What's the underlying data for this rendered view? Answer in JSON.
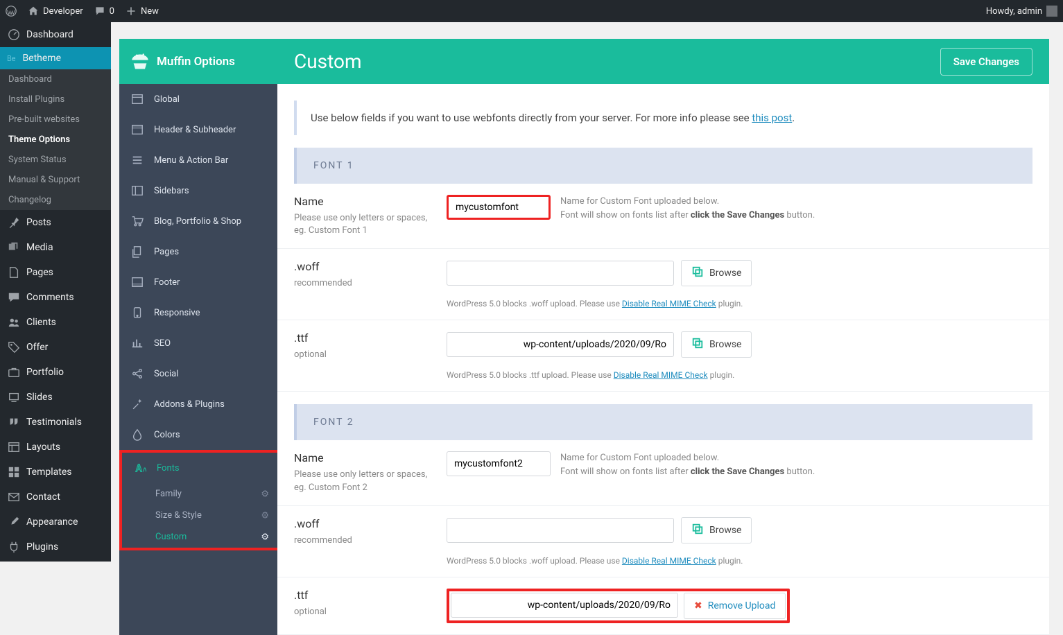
{
  "adminbar": {
    "site": "Developer",
    "comments": "0",
    "new": "New",
    "howdy": "Howdy, admin"
  },
  "wpmenu": {
    "dashboard": "Dashboard",
    "betheme": "Betheme",
    "sub": {
      "dashboard": "Dashboard",
      "install_plugins": "Install Plugins",
      "prebuilt": "Pre-built websites",
      "theme_options": "Theme Options",
      "system_status": "System Status",
      "manual": "Manual & Support",
      "changelog": "Changelog"
    },
    "posts": "Posts",
    "media": "Media",
    "pages": "Pages",
    "comments": "Comments",
    "clients": "Clients",
    "offer": "Offer",
    "portfolio": "Portfolio",
    "slides": "Slides",
    "testimonials": "Testimonials",
    "layouts": "Layouts",
    "templates": "Templates",
    "contact": "Contact",
    "appearance": "Appearance",
    "plugins": "Plugins"
  },
  "mfn": {
    "brand": "Muffin Options",
    "items": {
      "global": "Global",
      "header": "Header & Subheader",
      "menu": "Menu & Action Bar",
      "sidebars": "Sidebars",
      "blog": "Blog, Portfolio & Shop",
      "pages": "Pages",
      "footer": "Footer",
      "responsive": "Responsive",
      "seo": "SEO",
      "social": "Social",
      "addons": "Addons & Plugins",
      "colors": "Colors",
      "fonts": "Fonts"
    },
    "fontsubs": {
      "family": "Family",
      "size": "Size & Style",
      "custom": "Custom"
    }
  },
  "page": {
    "title": "Custom",
    "save": "Save Changes",
    "info_pre": "Use below fields if you want to use webfonts directly from your server. For more info please see ",
    "info_link": "this post",
    "info_post": ".",
    "font1": "FONT 1",
    "font2": "FONT 2",
    "name_label": "Name",
    "name_desc1": "Please use only letters or spaces, eg. Custom Font 1",
    "name_desc2": "Please use only letters or spaces, eg. Custom Font 2",
    "name_help_l1": "Name for Custom Font uploaded below.",
    "name_help_l2a": "Font will show on fonts list after ",
    "name_help_bold": "click the Save Changes",
    "name_help_l2b": " button.",
    "woff_label": ".woff",
    "woff_desc": "recommended",
    "ttf_label": ".ttf",
    "ttf_desc": "optional",
    "browse": "Browse",
    "remove": "Remove Upload",
    "woff_note_a": "WordPress 5.0 blocks .woff upload. Please use ",
    "ttf_note_a": "WordPress 5.0 blocks .ttf upload. Please use ",
    "mime_link": "Disable Real MIME Check",
    "note_b": " plugin.",
    "val": {
      "font1_name": "mycustomfont",
      "font1_woff": "",
      "font1_ttf": "wp-content/uploads/2020/09/Ro",
      "font2_name": "mycustomfont2",
      "font2_woff": "",
      "font2_ttf": "wp-content/uploads/2020/09/Ro"
    }
  }
}
